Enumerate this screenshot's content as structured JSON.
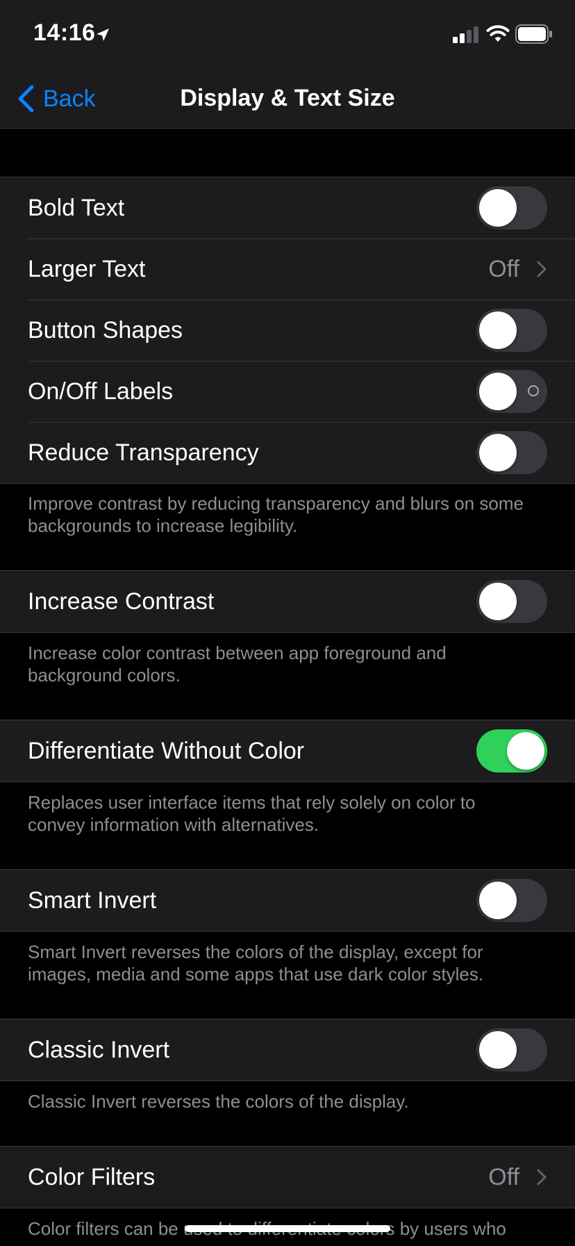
{
  "status_bar": {
    "time": "14:16",
    "icons": [
      "location-arrow-icon",
      "cellular-signal-icon",
      "wifi-icon",
      "battery-icon"
    ]
  },
  "nav": {
    "back_label": "Back",
    "title": "Display & Text Size"
  },
  "settings": {
    "bold_text": {
      "label": "Bold Text",
      "on": false
    },
    "larger_text": {
      "label": "Larger Text",
      "value": "Off"
    },
    "button_shapes": {
      "label": "Button Shapes",
      "on": false
    },
    "on_off_labels": {
      "label": "On/Off Labels",
      "on": false
    },
    "reduce_transparency": {
      "label": "Reduce Transparency",
      "on": false,
      "footer": "Improve contrast by reducing transparency and blurs on some backgrounds to increase legibility."
    },
    "increase_contrast": {
      "label": "Increase Contrast",
      "on": false,
      "footer": "Increase color contrast between app foreground and background colors."
    },
    "differentiate_without_color": {
      "label": "Differentiate Without Color",
      "on": true,
      "footer": "Replaces user interface items that rely solely on color to convey information with alternatives."
    },
    "smart_invert": {
      "label": "Smart Invert",
      "on": false,
      "footer": "Smart Invert reverses the colors of the display, except for images, media and some apps that use dark color styles."
    },
    "classic_invert": {
      "label": "Classic Invert",
      "on": false,
      "footer": "Classic Invert reverses the colors of the display."
    },
    "color_filters": {
      "label": "Color Filters",
      "value": "Off",
      "footer": "Color filters can be used to differentiate colors by users who"
    }
  },
  "colors": {
    "accent_blue": "#0a84ff",
    "toggle_on_green": "#30d158",
    "toggle_off_gray": "#39393d",
    "cell_background": "#1c1c1e",
    "page_background": "#000000",
    "secondary_text": "#8e8e93"
  }
}
